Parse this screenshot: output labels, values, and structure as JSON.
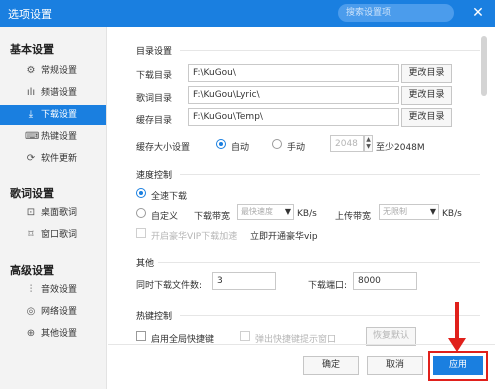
{
  "window": {
    "title": "选项设置",
    "search_placeholder": "搜索设置项",
    "close_glyph": "✕"
  },
  "sidebar": {
    "groups": [
      {
        "title": "基本设置",
        "items": [
          {
            "label": "常规设置",
            "icon": "gear-icon",
            "glyph": "⚙"
          },
          {
            "label": "频谱设置",
            "icon": "spectrum-icon",
            "glyph": "ılı"
          },
          {
            "label": "下载设置",
            "icon": "download-icon",
            "glyph": "⤓",
            "active": true
          },
          {
            "label": "热键设置",
            "icon": "keyboard-icon",
            "glyph": "⌨"
          },
          {
            "label": "软件更新",
            "icon": "update-icon",
            "glyph": "⟳"
          }
        ]
      },
      {
        "title": "歌词设置",
        "items": [
          {
            "label": "桌面歌词",
            "icon": "desktop-lyric-icon",
            "glyph": "⊡"
          },
          {
            "label": "窗口歌词",
            "icon": "window-lyric-icon",
            "glyph": "⌑"
          }
        ]
      },
      {
        "title": "高级设置",
        "items": [
          {
            "label": "音效设置",
            "icon": "equalizer-icon",
            "glyph": "⫶"
          },
          {
            "label": "网络设置",
            "icon": "network-icon",
            "glyph": "◎"
          },
          {
            "label": "其他设置",
            "icon": "other-icon",
            "glyph": "⊕"
          }
        ]
      }
    ]
  },
  "directory": {
    "title": "目录设置",
    "download_label": "下载目录",
    "download_value": "F:\\KuGou\\",
    "lyric_label": "歌词目录",
    "lyric_value": "F:\\KuGou\\Lyric\\",
    "cache_label": "缓存目录",
    "cache_value": "F:\\KuGou\\Temp\\",
    "change_label": "更改目录",
    "cache_size_label": "缓存大小设置",
    "auto_label": "自动",
    "manual_label": "手动",
    "cache_size_value": "2048",
    "cache_min_text": "至少2048M"
  },
  "speed": {
    "title": "速度控制",
    "full_label": "全速下载",
    "custom_label": "自定义",
    "down_bw_label": "下载带宽",
    "down_bw_value": "最快速度",
    "unit": "KB/s",
    "up_bw_label": "上传带宽",
    "up_bw_value": "无限制",
    "vip_label": "开启豪华VIP下载加速",
    "vip_link": "立即开通豪华vip"
  },
  "other": {
    "title": "其他",
    "concurrent_label": "同时下载文件数:",
    "concurrent_value": "3",
    "port_label": "下载端口:",
    "port_value": "8000"
  },
  "hotkey": {
    "title": "热键控制",
    "global_label": "启用全局快捷键",
    "popup_label": "弹出快捷键提示窗口",
    "restore_label": "恢复默认"
  },
  "footer": {
    "ok_label": "确定",
    "cancel_label": "取消",
    "apply_label": "应用"
  },
  "colors": {
    "accent": "#1a7fe0",
    "highlight": "#e0201b"
  }
}
